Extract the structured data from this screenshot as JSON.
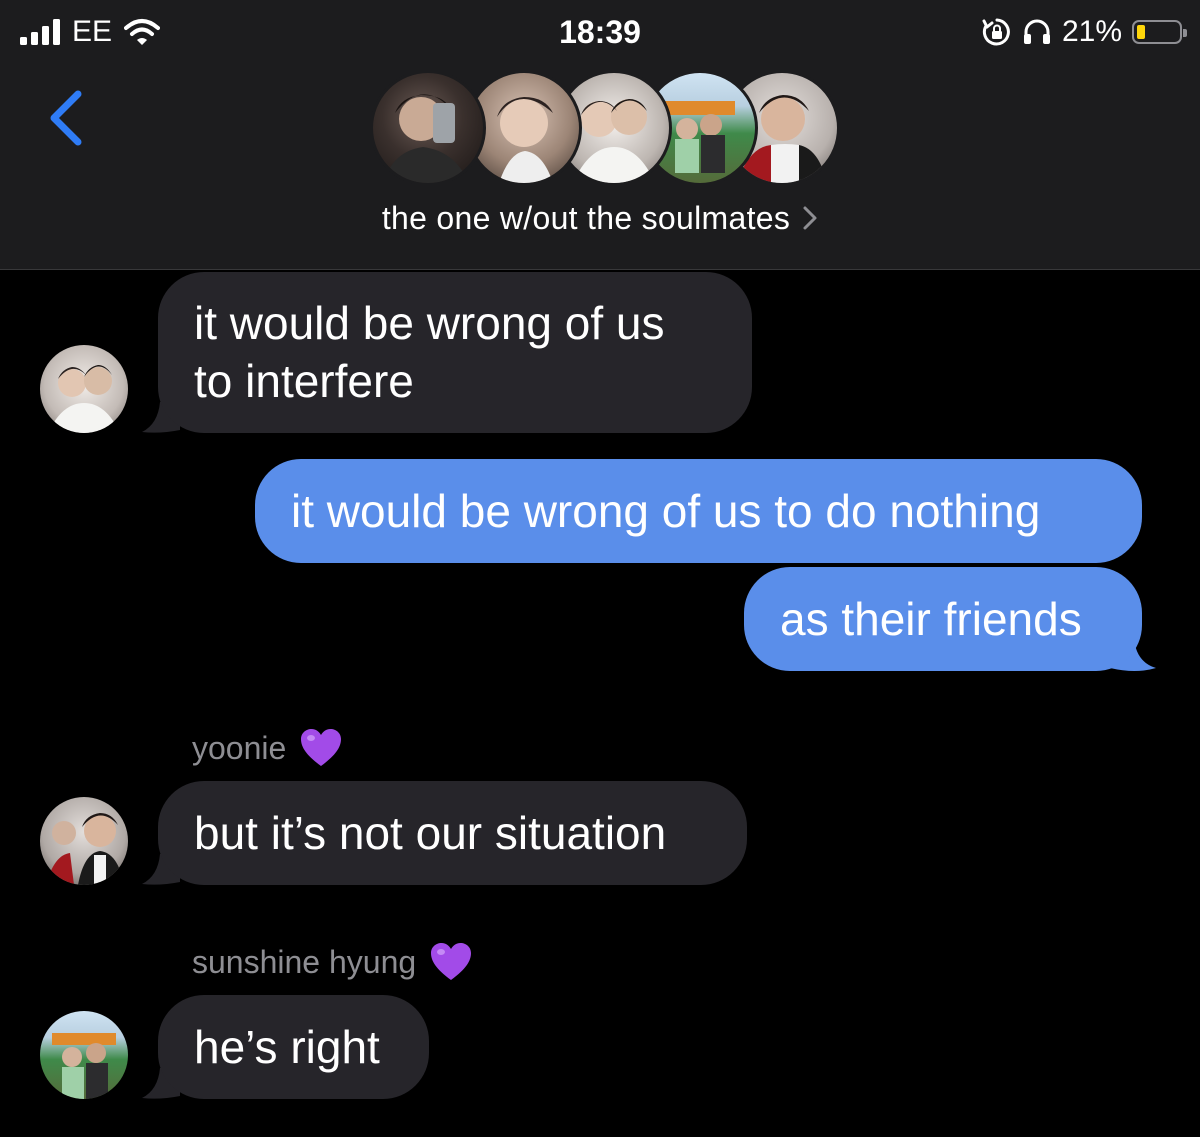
{
  "status_bar": {
    "carrier": "EE",
    "time": "18:39",
    "battery_percent": "21%",
    "battery_level": 0.21,
    "icons": [
      "signal-icon",
      "wifi-icon",
      "rotation-lock-icon",
      "headphones-icon",
      "battery-icon"
    ]
  },
  "header": {
    "back_icon": "chevron-left-icon",
    "group_title": "the one w/out the soulmates",
    "title_chevron": "›",
    "member_count": 5
  },
  "messages": [
    {
      "direction": "incoming",
      "sender": "",
      "text_lines": [
        "it would be wrong of us",
        "to interfere"
      ]
    },
    {
      "direction": "outgoing",
      "text": "it would be wrong of us to do nothing"
    },
    {
      "direction": "outgoing",
      "text": "as their friends"
    },
    {
      "direction": "incoming",
      "sender": "yoonie 💜",
      "sender_name": "yoonie",
      "text": "but it’s not our situation"
    },
    {
      "direction": "incoming",
      "sender": "sunshine hyung 💜",
      "sender_name": "sunshine hyung",
      "text": "he’s right"
    }
  ],
  "colors": {
    "background": "#000000",
    "header_bg": "#1c1c1e",
    "incoming_bubble": "#26252a",
    "outgoing_bubble": "#5a8eea",
    "accent_blue": "#2f7cf6",
    "secondary_text": "#8e8e93",
    "heart": "#a24be8"
  }
}
